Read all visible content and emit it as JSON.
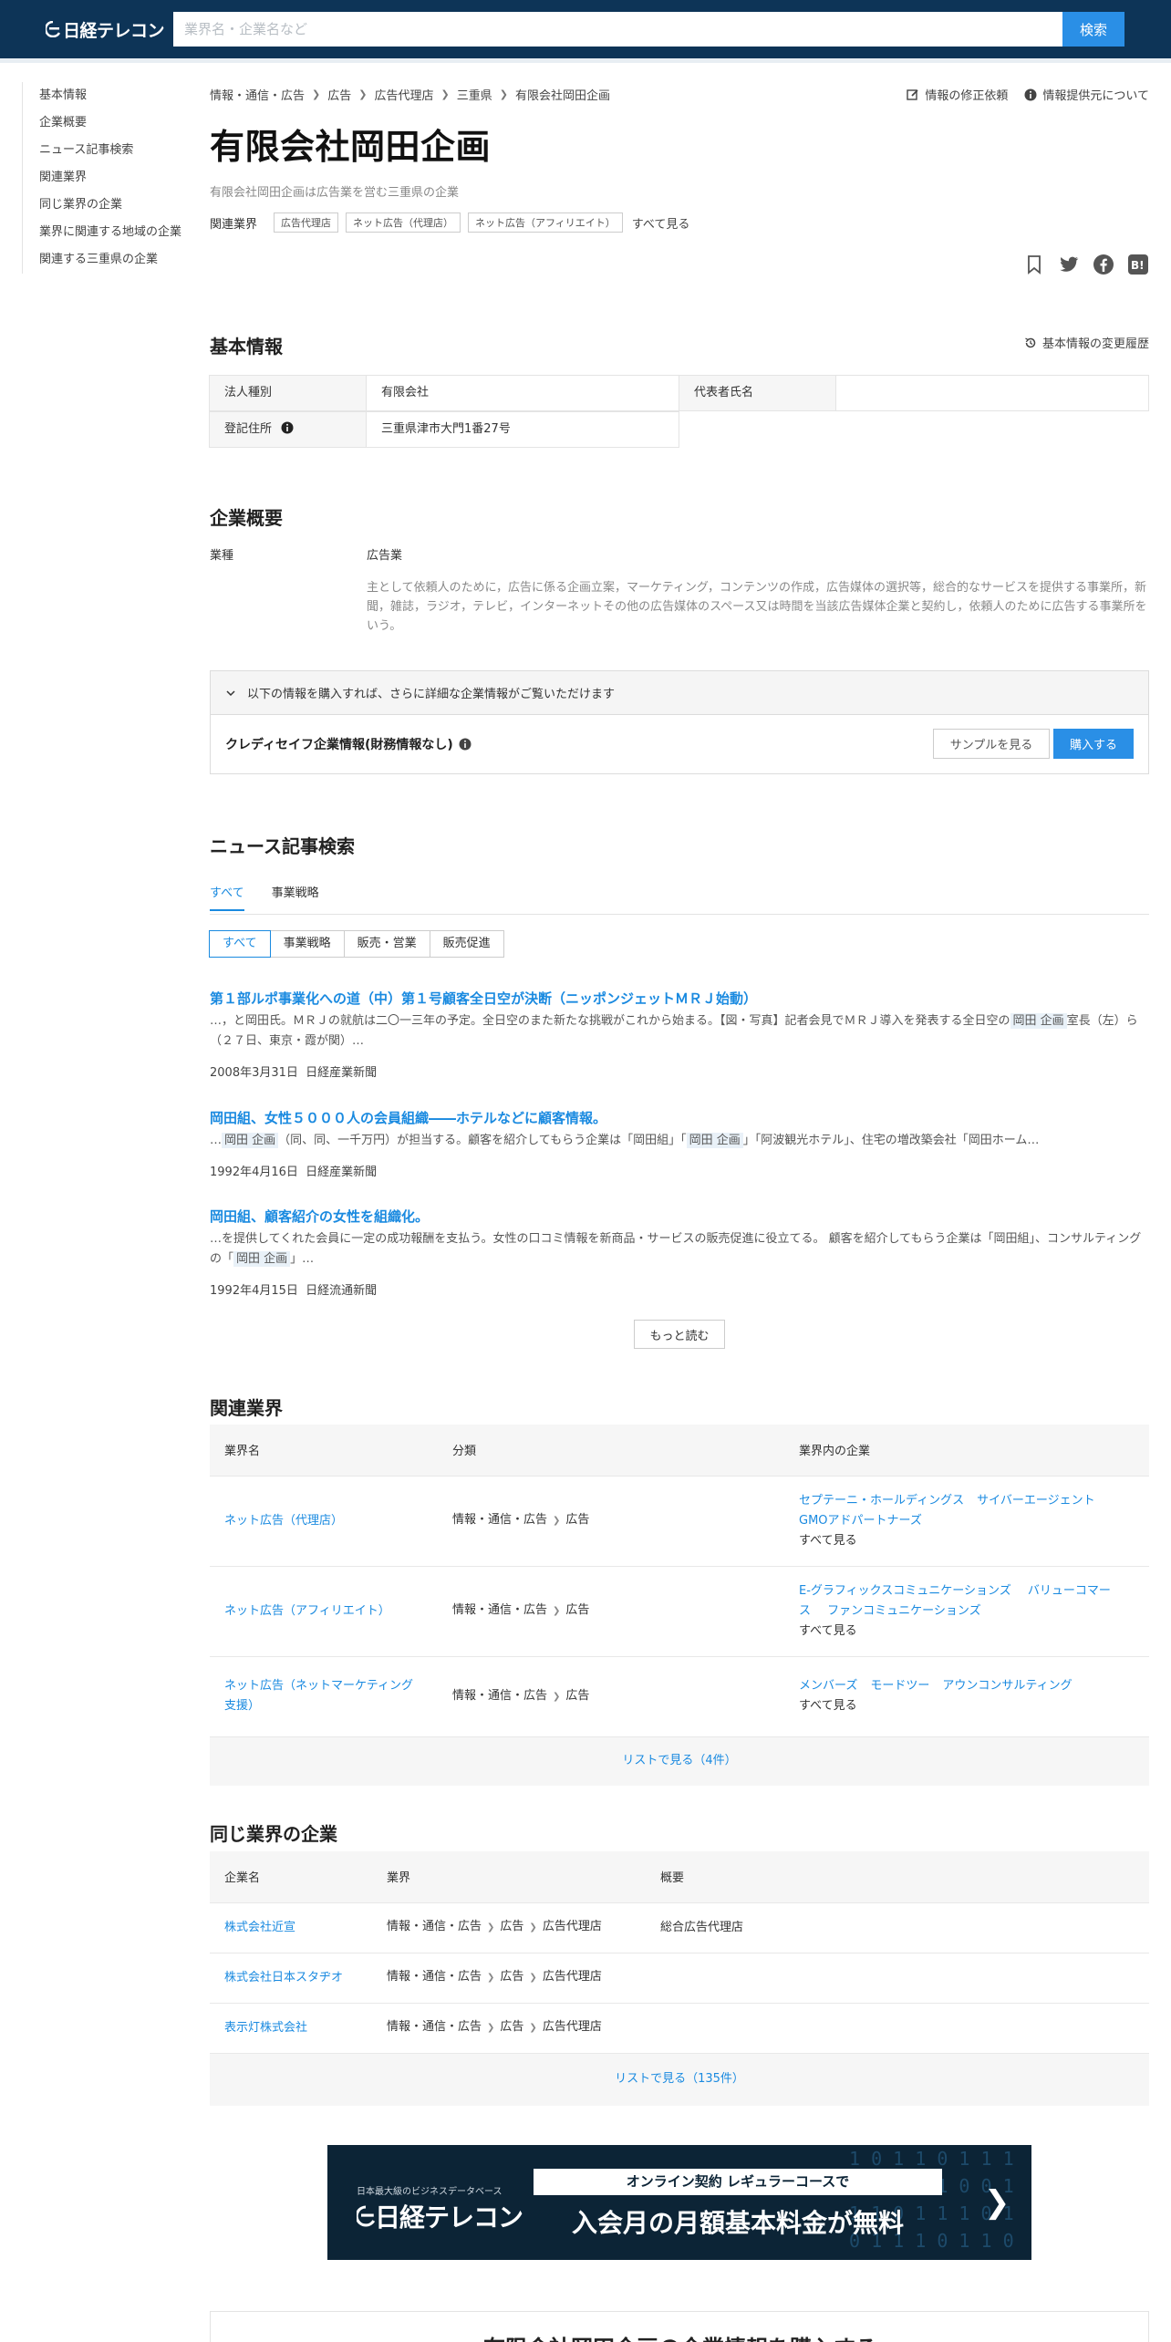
{
  "header": {
    "logo_text": "日経テレコン",
    "search_placeholder": "業界名・企業名など",
    "search_button": "検索"
  },
  "sidenav": {
    "items": [
      "基本情報",
      "企業概要",
      "ニュース記事検索",
      "関連業界",
      "同じ業界の企業",
      "業界に関連する地域の企業",
      "関連する三重県の企業"
    ]
  },
  "breadcrumb": [
    "情報・通信・広告",
    "広告",
    "広告代理店",
    "三重県",
    "有限会社岡田企画"
  ],
  "top_links": {
    "correction": "情報の修正依頼",
    "source": "情報提供元について"
  },
  "company": {
    "name": "有限会社岡田企画",
    "subtitle": "有限会社岡田企画は広告業を営む三重県の企業",
    "industry_label": "関連業界",
    "industry_tags": [
      "広告代理店",
      "ネット広告（代理店）",
      "ネット広告（アフィリエイト）"
    ],
    "see_all": "すべて見る"
  },
  "share_icons": [
    "bookmark-icon",
    "twitter-icon",
    "facebook-icon",
    "hatena-icon"
  ],
  "basic_info": {
    "heading": "基本情報",
    "history_link": "基本情報の変更履歴",
    "corp_type_label": "法人種別",
    "corp_type_value": "有限会社",
    "rep_label": "代表者氏名",
    "rep_value": "",
    "address_label": "登記住所",
    "address_value": "三重県津市大門1番27号"
  },
  "overview": {
    "heading": "企業概要",
    "label": "業種",
    "value": "広告業",
    "description": "主として依頼人のために，広告に係る企画立案，マーケティング，コンテンツの作成，広告媒体の選択等，総合的なサービスを提供する事業所，新聞，雑誌，ラジオ，テレビ，インターネットその他の広告媒体のスペース又は時間を当該広告媒体企業と契約し，依頼人のために広告する事業所をいう。"
  },
  "purchase": {
    "notice": "以下の情報を購入すれば、さらに詳細な企業情報がご覧いただけます",
    "product": "クレディセイフ企業情報(財務情報なし)",
    "sample_button": "サンプルを見る",
    "buy_button": "購入する"
  },
  "news": {
    "heading": "ニュース記事検索",
    "tabs": [
      "すべて",
      "事業戦略"
    ],
    "chips": [
      "すべて",
      "事業戦略",
      "販売・営業",
      "販売促進"
    ],
    "articles": [
      {
        "title": "第１部ルポ事業化への道（中）第１号顧客全日空が決断（ニッポンジェットＭＲＪ始動）",
        "snippet_pre": "…，と岡田氏。ＭＲＪの就航は二〇一三年の予定。全日空のまた新たな挑戦がこれから始まる。【図・写真】記者会見でＭＲＪ導入を発表する全日空の",
        "highlight": "岡田 企画",
        "snippet_post": "室長（左）ら（２７日、東京・霞が関）…",
        "date": "2008年3月31日",
        "source": "日経産業新聞"
      },
      {
        "title": "岡田組、女性５０００人の会員組織――ホテルなどに顧客情報。",
        "snippet_pre": "…",
        "highlight": "岡田 企画",
        "snippet_mid": "（同、同、一千万円）が担当する。顧客を紹介してもらう企業は「岡田組」「",
        "highlight2": "岡田 企画",
        "snippet_post": "」「阿波観光ホテル」、住宅の増改築会社「岡田ホーム…",
        "date": "1992年4月16日",
        "source": "日経産業新聞"
      },
      {
        "title": "岡田組、顧客紹介の女性を組織化。",
        "snippet_pre": "…を提供してくれた会員に一定の成功報酬を支払う。女性の口コミ情報を新商品・サービスの販売促進に役立てる。 顧客を紹介してもらう企業は「岡田組」、コンサルティングの「",
        "highlight": "岡田 企画",
        "snippet_post": "」…",
        "date": "1992年4月15日",
        "source": "日経流通新聞"
      }
    ],
    "more_button": "もっと読む"
  },
  "related_industries": {
    "heading": "関連業界",
    "columns": [
      "業界名",
      "分類",
      "業界内の企業"
    ],
    "rows": [
      {
        "name": "ネット広告（代理店）",
        "path": [
          "情報・通信・広告",
          "広告"
        ],
        "companies": [
          "セプテーニ・ホールディングス",
          "サイバーエージェント",
          "GMOアドパートナーズ"
        ],
        "see_all": "すべて見る"
      },
      {
        "name": "ネット広告（アフィリエイト）",
        "path": [
          "情報・通信・広告",
          "広告"
        ],
        "companies": [
          "E-グラフィックスコミュニケーションズ",
          "バリューコマース",
          "ファンコミュニケーションズ"
        ],
        "see_all": "すべて見る"
      },
      {
        "name": "ネット広告（ネットマーケティング支援）",
        "path": [
          "情報・通信・広告",
          "広告"
        ],
        "companies": [
          "メンバーズ",
          "モードツー",
          "アウンコンサルティング"
        ],
        "see_all": "すべて見る"
      }
    ],
    "list_link": "リストで見る（4件）"
  },
  "same_industry": {
    "heading": "同じ業界の企業",
    "columns": [
      "企業名",
      "業界",
      "概要"
    ],
    "rows": [
      {
        "name": "株式会社近宣",
        "path": [
          "情報・通信・広告",
          "広告",
          "広告代理店"
        ],
        "summary": "総合広告代理店"
      },
      {
        "name": "株式会社日本スタヂオ",
        "path": [
          "情報・通信・広告",
          "広告",
          "広告代理店"
        ],
        "summary": ""
      },
      {
        "name": "表示灯株式会社",
        "path": [
          "情報・通信・広告",
          "広告",
          "広告代理店"
        ],
        "summary": ""
      }
    ],
    "list_link": "リストで見る（135件）"
  },
  "banner": {
    "small": "日本最大級のビジネスデータベース",
    "logo": "日経テレコン",
    "pill": "オンライン契約 レギュラーコースで",
    "big": "入会月の月額基本料金が無料"
  },
  "bottom": {
    "title": "有限会社岡田企画の企業情報を購入する"
  }
}
